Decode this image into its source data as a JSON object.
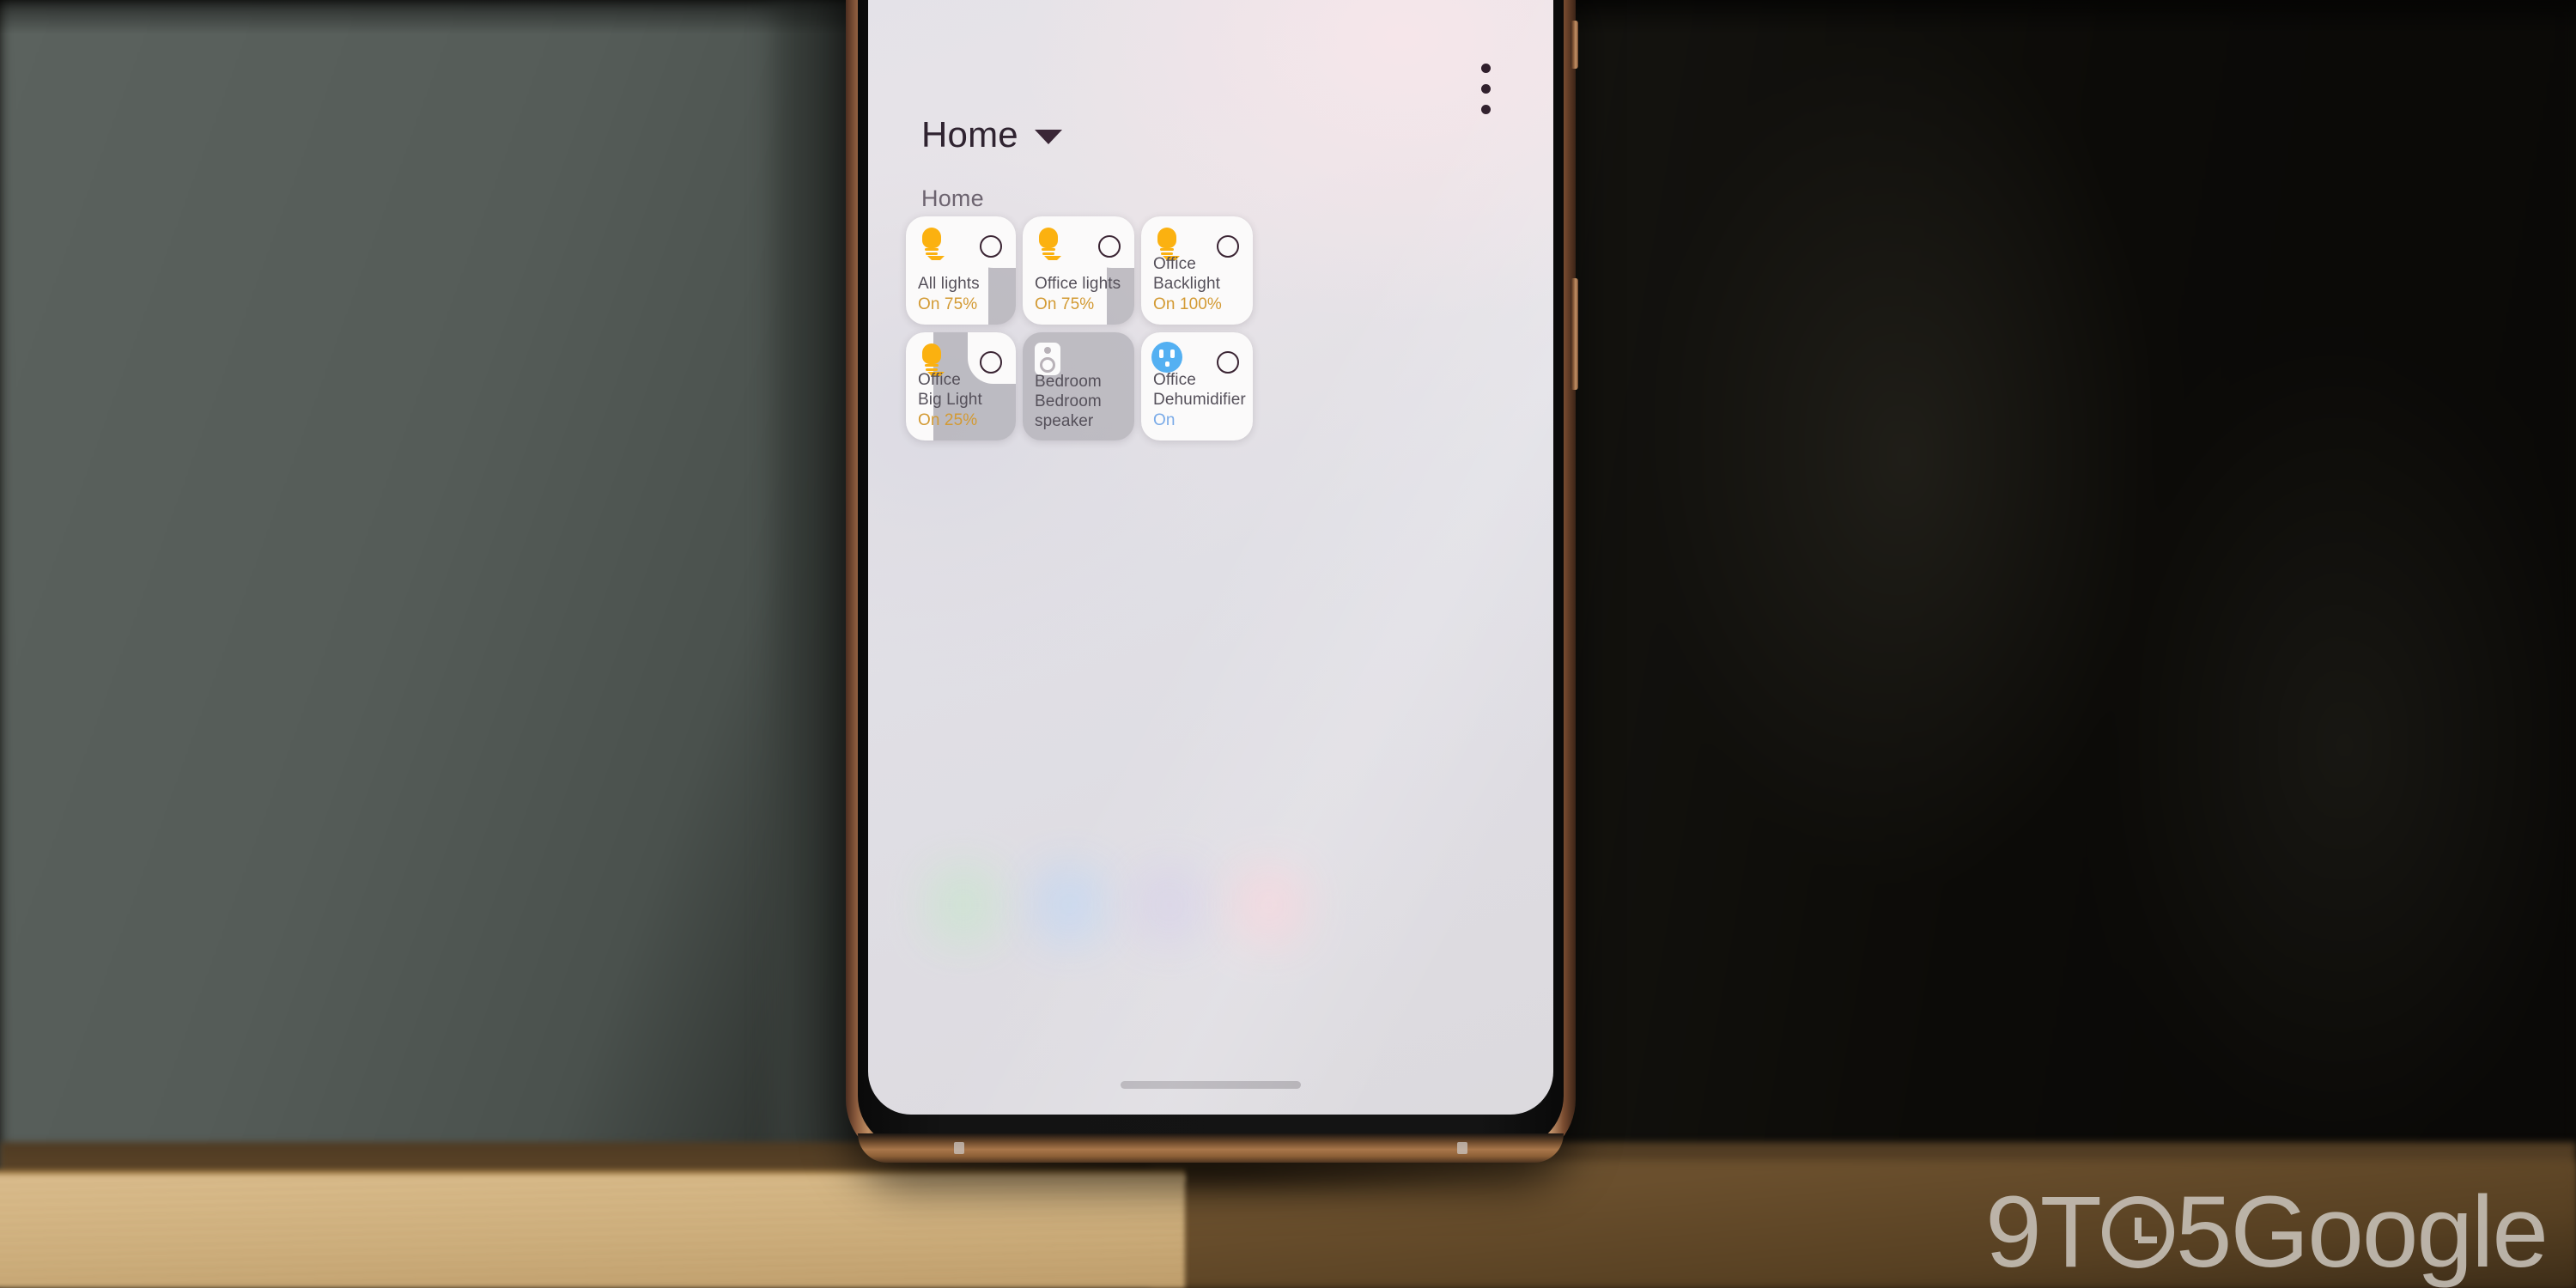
{
  "photo": {
    "watermark": {
      "before": "9T",
      "clock_icon": "clock-icon",
      "after": "5Google"
    }
  },
  "app": {
    "overflow_menu": {
      "icon": "more-vertical-icon",
      "label": "More options"
    },
    "header": {
      "title": "Home",
      "dropdown_icon": "caret-down-icon"
    },
    "section_label": "Home",
    "cards": [
      {
        "name": "All lights",
        "status": "On 75%",
        "status_color": "#d39a33",
        "icon": "lightbulb-icon",
        "toggle_icon": "toggle-circle-icon",
        "fill_percent": 75,
        "state": "on"
      },
      {
        "name": "Office lights",
        "status": "On 75%",
        "status_color": "#d39a33",
        "icon": "lightbulb-icon",
        "toggle_icon": "toggle-circle-icon",
        "fill_percent": 75,
        "state": "on"
      },
      {
        "name": "Office\nBacklight",
        "name_line1": "Office",
        "name_line2": "Backlight",
        "status": "On 100%",
        "status_color": "#d39a33",
        "icon": "lightbulb-icon",
        "toggle_icon": "toggle-circle-icon",
        "fill_percent": 100,
        "state": "on"
      },
      {
        "name_line1": "Office",
        "name_line2": "Big Light",
        "status": "On 25%",
        "status_color": "#d39a33",
        "icon": "lightbulb-icon",
        "toggle_icon": "toggle-circle-icon",
        "fill_percent": 25,
        "state": "on"
      },
      {
        "name_line1": "Bedroom",
        "name_line2": "Bedroom speaker",
        "status": "",
        "status_color": "",
        "icon": "speaker-icon",
        "toggle_icon": "",
        "fill_percent": 0,
        "state": "idle"
      },
      {
        "name_line1": "Office",
        "name_line2": "Dehumidifier",
        "status": "On",
        "status_color": "#7aabe8",
        "icon": "power-outlet-icon",
        "toggle_icon": "toggle-circle-icon",
        "fill_percent": 100,
        "state": "on"
      }
    ],
    "dock_icons": [
      "app-icon-green",
      "app-icon-blue",
      "app-icon-lavender",
      "app-icon-pink"
    ],
    "gesture_bar": "home-gesture-bar"
  },
  "colors": {
    "amber": "#fbb110",
    "outlet_blue": "#54b0f2",
    "card_track": "#a8a6ac",
    "card_fill": "#fbfafa",
    "toggle_outline": "#3a2433"
  }
}
